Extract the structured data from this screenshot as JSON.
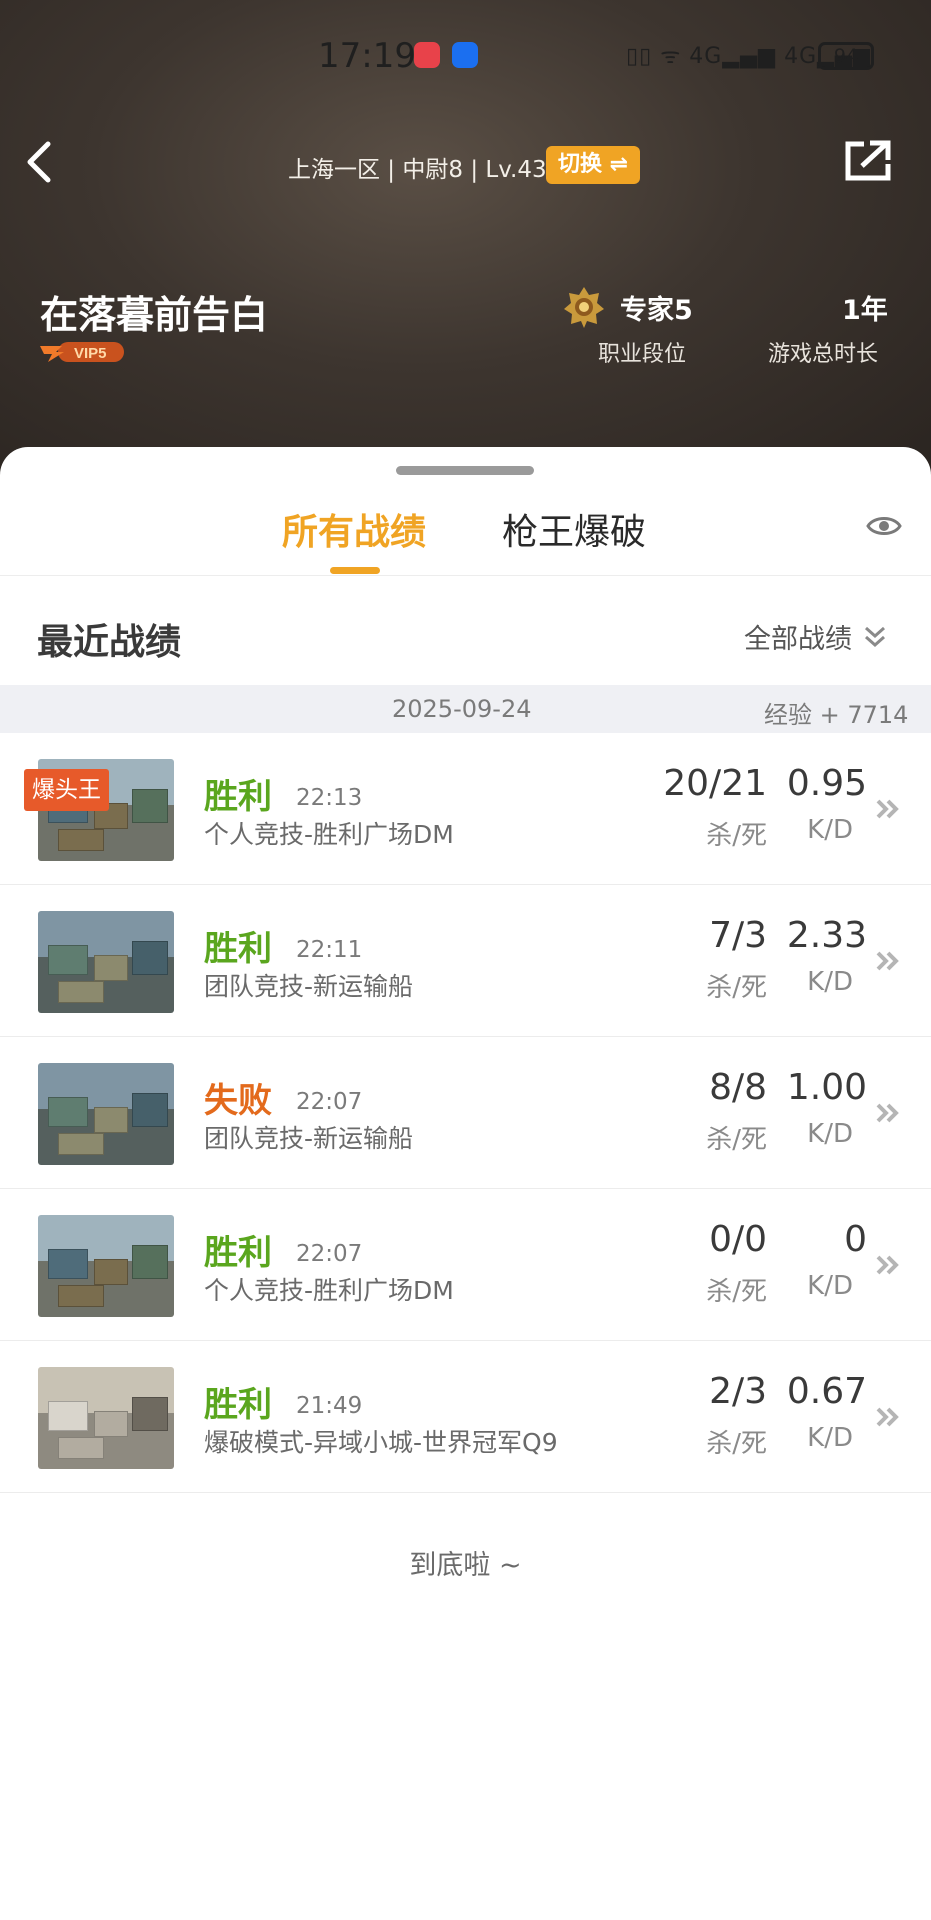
{
  "status_bar": {
    "time": "17:19",
    "signal_text": "▯▯ ᯤ 4G▂▄▆ 4G▂▄▆",
    "battery": "94"
  },
  "header": {
    "server_info": "上海一区 | 中尉8 | Lv.43",
    "switch_label": "切换 ⇌",
    "player_name": "在落暮前告白",
    "vip_label": "VIP5",
    "rank_value": "专家5",
    "rank_label": "职业段位",
    "play_time_value": "1年",
    "play_time_label": "游戏总时长"
  },
  "tabs": [
    {
      "label": "所有战绩",
      "active": true
    },
    {
      "label": "枪王爆破",
      "active": false
    }
  ],
  "section": {
    "title": "最近战绩",
    "filter_label": "全部战绩"
  },
  "date_group": {
    "date": "2025-09-24",
    "exp": "经验 + 7714"
  },
  "matches": [
    {
      "result": "胜利",
      "outcome": "win",
      "time": "22:13",
      "mode": "个人竞技-胜利广场DM",
      "kills_deaths": "20/21",
      "kd_label": "杀/死",
      "kd_ratio": "0.95",
      "ratio_label": "K/D",
      "tag": "爆头王",
      "map": "square"
    },
    {
      "result": "胜利",
      "outcome": "win",
      "time": "22:11",
      "mode": "团队竞技-新运输船",
      "kills_deaths": "7/3",
      "kd_label": "杀/死",
      "kd_ratio": "2.33",
      "ratio_label": "K/D",
      "tag": "",
      "map": "ship"
    },
    {
      "result": "失败",
      "outcome": "lose",
      "time": "22:07",
      "mode": "团队竞技-新运输船",
      "kills_deaths": "8/8",
      "kd_label": "杀/死",
      "kd_ratio": "1.00",
      "ratio_label": "K/D",
      "tag": "",
      "map": "ship"
    },
    {
      "result": "胜利",
      "outcome": "win",
      "time": "22:07",
      "mode": "个人竞技-胜利广场DM",
      "kills_deaths": "0/0",
      "kd_label": "杀/死",
      "kd_ratio": "0",
      "ratio_label": "K/D",
      "tag": "",
      "map": "square"
    },
    {
      "result": "胜利",
      "outcome": "win",
      "time": "21:49",
      "mode": "爆破模式-异域小城-世界冠军Q9",
      "kills_deaths": "2/3",
      "kd_label": "杀/死",
      "kd_ratio": "0.67",
      "ratio_label": "K/D",
      "tag": "",
      "map": "town"
    }
  ],
  "footer": {
    "end_text": "到底啦 ~"
  },
  "colors": {
    "accent": "#f0a424",
    "win": "#5aa61e",
    "lose": "#e36a1c",
    "tag": "#e75a2a"
  }
}
